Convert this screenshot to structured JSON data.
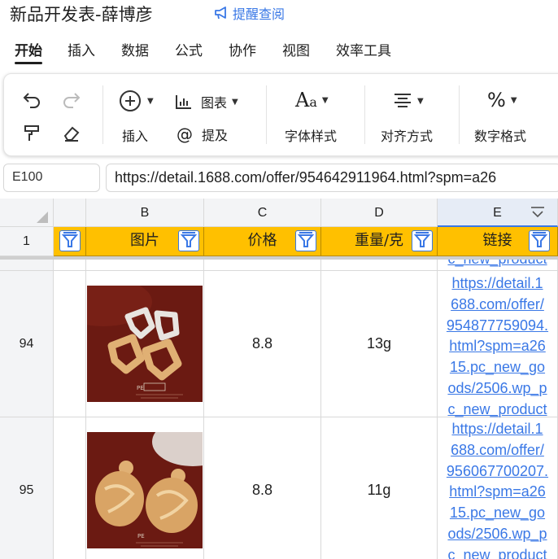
{
  "title": "新品开发表-薛博彦",
  "remind_label": "提醒查阅",
  "menu": [
    "开始",
    "插入",
    "数据",
    "公式",
    "协作",
    "视图",
    "效率工具"
  ],
  "toolbar": {
    "insert_label": "插入",
    "chart_label": "图表",
    "mention_label": "提及",
    "font_label": "字体样式",
    "align_label": "对齐方式",
    "number_label": "数字格式"
  },
  "cell_ref": "E100",
  "formula_value": "https://detail.1688.com/offer/954642911964.html?spm=a26",
  "columns": [
    "B",
    "C",
    "D",
    "E"
  ],
  "header_row_num": "1",
  "headers": [
    "图片",
    "价格",
    "重量/克",
    "链接"
  ],
  "partial_link_text": "c_new_product",
  "rows": [
    {
      "row_num": "94",
      "price": "8.8",
      "weight": "13g",
      "link_lines": [
        "https://detail.1",
        "688.com/offer/",
        "954877759094.",
        "html?spm=a26",
        "15.pc_new_go",
        "ods/2506.wp_p",
        "c_new_product"
      ],
      "image": "earring-white-gold-angular"
    },
    {
      "row_num": "95",
      "price": "8.8",
      "weight": "11g",
      "link_lines": [
        "https://detail.1",
        "688.com/offer/",
        "956067700207.",
        "html?spm=a26",
        "15.pc_new_go",
        "ods/2506.wp_p",
        "c_new_product"
      ],
      "image": "earring-gold-round"
    }
  ],
  "colors": {
    "accent": "#3a78e6",
    "header_fill": "#ffc000",
    "image_bg": "#6b1a12"
  },
  "icons": [
    "undo-icon",
    "redo-icon",
    "format-painter-icon",
    "eraser-icon",
    "plus-circle-icon",
    "bar-chart-icon",
    "at-icon",
    "font-icon",
    "align-icon",
    "percent-icon",
    "filter-icon",
    "megaphone-icon"
  ]
}
